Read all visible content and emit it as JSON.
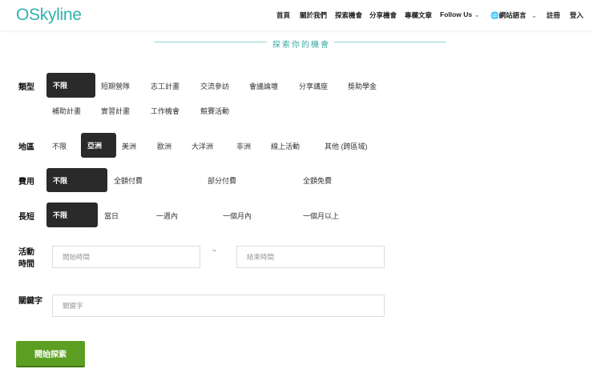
{
  "header": {
    "logo": "OSkyline",
    "nav": [
      "首頁",
      "關於我們",
      "探索機會",
      "分享機會",
      "專欄文章",
      "Follow Us",
      "網站語言",
      "註冊",
      "登入"
    ]
  },
  "title": "探索你的機會",
  "filters": {
    "type": {
      "label": "類型",
      "selected": "不限",
      "options": [
        "短期營隊",
        "志工計畫",
        "交流參訪",
        "會議論壇",
        "分享講座",
        "獎助學金",
        "補助計畫",
        "實習計畫",
        "工作機會",
        "競賽活動"
      ]
    },
    "region": {
      "label": "地區",
      "options": [
        "不限",
        "亞洲",
        "美洲",
        "歐洲",
        "大洋洲",
        "非洲",
        "線上活動",
        "其他 (跨區域)"
      ],
      "selected": "亞洲"
    },
    "fee": {
      "label": "費用",
      "selected": "不限",
      "options": [
        "全額付費",
        "部分付費",
        "全額免費"
      ]
    },
    "length": {
      "label": "長短",
      "selected": "不限",
      "options": [
        "當日",
        "一週內",
        "一個月內",
        "一個月以上"
      ]
    },
    "time": {
      "label1": "活動",
      "label2": "時間",
      "start_placeholder": "開始時間",
      "separator": "~",
      "end_placeholder": "結束時間"
    },
    "keyword": {
      "label": "關鍵字",
      "placeholder": "關鍵字"
    }
  },
  "search_button": "開始探索",
  "colors": {
    "accent": "#2fb3ad",
    "button": "#5c9e22",
    "selected": "#2a2a2a"
  }
}
